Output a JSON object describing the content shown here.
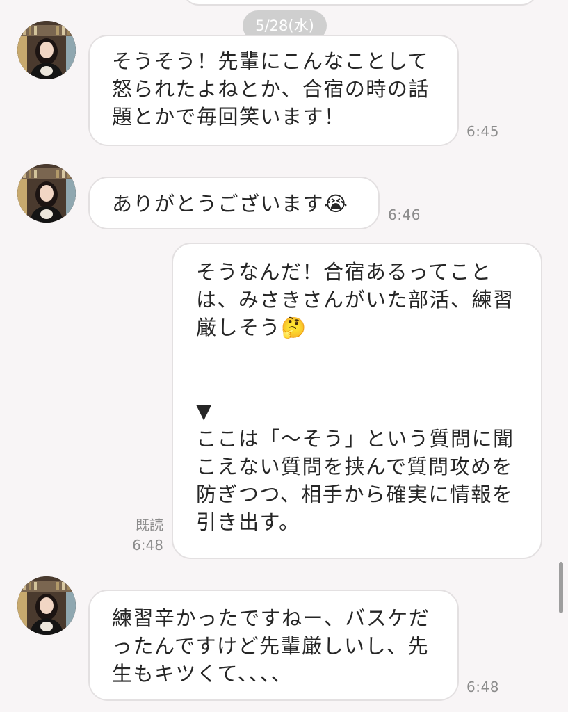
{
  "date_separator": "5/28(水)",
  "messages": [
    {
      "sender": "them",
      "lines": [
        "そうそう！先輩にこんなことして",
        "怒られたよねとか、合宿の時の話",
        "題とかで毎回笑います！"
      ],
      "time": "6:45"
    },
    {
      "sender": "them",
      "text": "ありがとうございます",
      "emoji": "😭",
      "time": "6:46"
    },
    {
      "sender": "me",
      "lines": [
        "そうなんだ！合宿あるってこと",
        "は、みさきさんがいた部活、練習",
        "厳しそう"
      ],
      "emoji": "🤔",
      "note_marker": "▼",
      "note_lines": [
        "ここは「〜そう」という質問に聞",
        "こえない質問を挟んで質問攻めを",
        "防ぎつつ、相手から確実に情報を",
        "引き出す。"
      ],
      "read_label": "既読",
      "time": "6:48"
    },
    {
      "sender": "them",
      "lines": [
        "練習辛かったですねー、バスケだ",
        "ったんですけど先輩厳しいし、先",
        "生もキツくて、、、、"
      ],
      "time": "6:48"
    }
  ],
  "colors": {
    "background": "#f8f5f6",
    "bubble": "#ffffff",
    "bubble_border": "#e3e0e1",
    "date_pill": "#cfcfcf",
    "timestamp": "#8c8c8c"
  }
}
